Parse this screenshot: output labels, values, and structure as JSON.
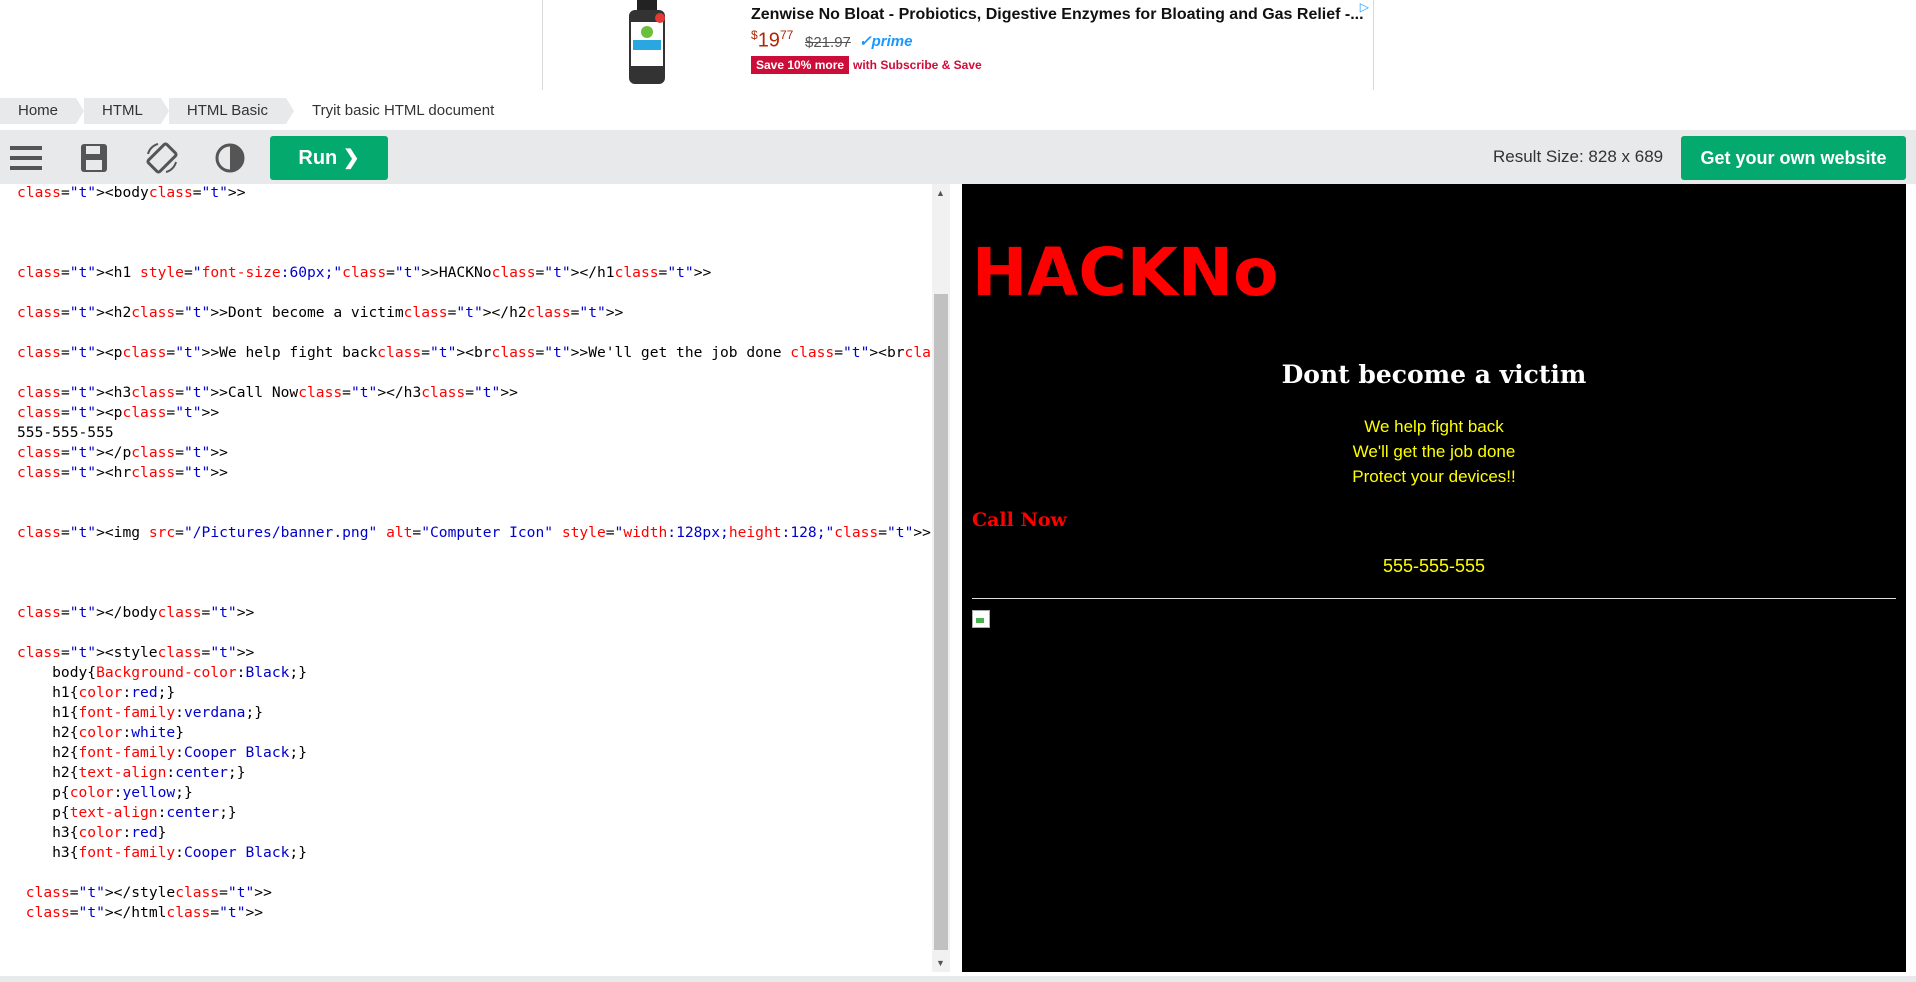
{
  "ad": {
    "title": "Zenwise No Bloat - Probiotics, Digestive Enzymes for Bloating and Gas Relief -...",
    "price_dollars": "19",
    "price_cents": "77",
    "price_currency": "$",
    "old_price": "$21.97",
    "prime": "prime",
    "badge": "Save 10% more",
    "subscribe": "with Subscribe & Save"
  },
  "breadcrumb": [
    "Home",
    "HTML",
    "HTML Basic",
    "Tryit basic HTML document"
  ],
  "toolbar": {
    "run_label": "Run",
    "result_size": "Result Size: 828 x 689",
    "own_website": "Get your own website"
  },
  "editor": {
    "lines": [
      "<body>",
      "",
      "",
      "",
      "<h1 style=\"font-size:60px;\">HACKNo</h1>",
      "",
      "<h2>Dont become a victim</h2>",
      "",
      "<p>We help fight back<br>We'll get the job done <br>Protect your devices!!</p>",
      "",
      "<h3>Call Now</h3>",
      "<p>",
      "555-555-555",
      "</p>",
      "<hr>",
      "",
      "",
      "<img src=\"/Pictures/banner.png\" alt=\"Computer Icon\" style=\"width:128px;height:128;\">",
      "",
      "",
      "",
      "</body>",
      "",
      "<style>",
      "    body{Background-color:Black;}",
      "    h1{color:red;}",
      "    h1{font-family:verdana;}",
      "    h2{color:white}",
      "    h2{font-family:Cooper Black;}",
      "    h2{text-align:center;}",
      "    p{color:yellow;}",
      "    p{text-align:center;}",
      "    h3{color:red}",
      "    h3{font-family:Cooper Black;}",
      "",
      " </style>",
      " </html>"
    ]
  },
  "result": {
    "h1": "HACKNo",
    "h2": "Dont become a victim",
    "p_lines": [
      "We help fight back",
      "We'll get the job done",
      "Protect your devices!!"
    ],
    "h3": "Call Now",
    "phone": "555-555-555"
  },
  "colors": {
    "brand_green": "#04aa6d",
    "result_bg": "#000000",
    "h1_color": "#ff0000",
    "p_color": "#ffff00"
  }
}
